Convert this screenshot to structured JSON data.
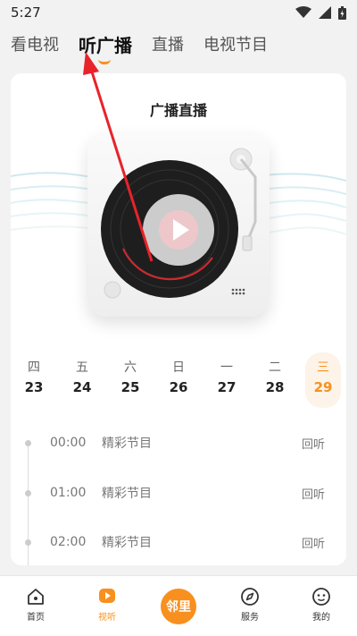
{
  "status_bar": {
    "time": "5:27",
    "icons": [
      "wifi-icon",
      "signal-icon",
      "battery-icon"
    ]
  },
  "top_tabs": [
    {
      "label": "看电视",
      "active": false
    },
    {
      "label": "听广播",
      "active": true
    },
    {
      "label": "直播",
      "active": false
    },
    {
      "label": "电视节目",
      "active": false
    }
  ],
  "card": {
    "title": "广播直播",
    "player_icon": "record-player-icon",
    "play_icon": "play-icon"
  },
  "dates": [
    {
      "weekday": "四",
      "day": "23",
      "active": false
    },
    {
      "weekday": "五",
      "day": "24",
      "active": false
    },
    {
      "weekday": "六",
      "day": "25",
      "active": false
    },
    {
      "weekday": "日",
      "day": "26",
      "active": false
    },
    {
      "weekday": "一",
      "day": "27",
      "active": false
    },
    {
      "weekday": "二",
      "day": "28",
      "active": false
    },
    {
      "weekday": "三",
      "day": "29",
      "active": true
    }
  ],
  "schedule": [
    {
      "time": "00:00",
      "program": "精彩节目",
      "action": "回听"
    },
    {
      "time": "01:00",
      "program": "精彩节目",
      "action": "回听"
    },
    {
      "time": "02:00",
      "program": "精彩节目",
      "action": "回听"
    }
  ],
  "bottom_nav": {
    "home": {
      "label": "首页",
      "icon": "home-icon"
    },
    "watch": {
      "label": "视听",
      "icon": "video-icon"
    },
    "center": {
      "label": "邻里"
    },
    "service": {
      "label": "服务",
      "icon": "compass-icon"
    },
    "mine": {
      "label": "我的",
      "icon": "profile-icon"
    }
  },
  "colors": {
    "accent": "#f7901e",
    "annotation_arrow": "#e8232a",
    "background": "#f2f2f2"
  }
}
